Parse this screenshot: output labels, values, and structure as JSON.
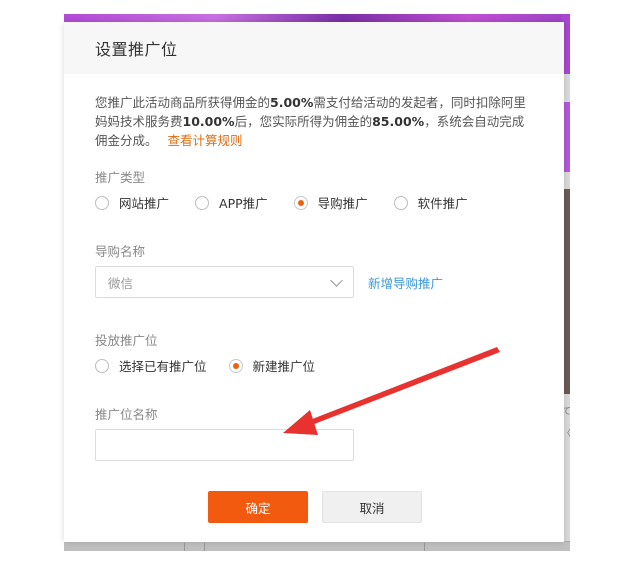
{
  "modal": {
    "title": "设置推广位",
    "notice": {
      "p1": "您推广此活动商品所获得佣金的",
      "v1": "5.00%",
      "p2": "需支付给活动的发起者，同时扣除阿里妈妈技术服务费",
      "v2": "10.00%",
      "p3": "后，您实际所得为佣金的",
      "v3": "85.00%",
      "p4": "，系统会自动完成佣金分成。",
      "link": "查看计算规则"
    },
    "promo_type": {
      "label": "推广类型",
      "options": [
        "网站推广",
        "APP推广",
        "导购推广",
        "软件推广"
      ],
      "selected_index": 2
    },
    "guide_name": {
      "label": "导购名称",
      "value": "微信",
      "add_link": "新增导购推广"
    },
    "placement": {
      "label": "投放推广位",
      "options": [
        "选择已有推广位",
        "新建推广位"
      ],
      "selected_index": 1
    },
    "placement_name": {
      "label": "推广位名称",
      "value": "",
      "placeholder": ""
    },
    "buttons": {
      "confirm": "确定",
      "cancel": "取消"
    }
  },
  "background": {
    "glyphs": [
      "て",
      "〈"
    ]
  },
  "colors": {
    "accent": "#f25a0f",
    "link_orange": "#e06d10",
    "link_blue": "#3a9ad9",
    "arrow": "#e8322f"
  }
}
